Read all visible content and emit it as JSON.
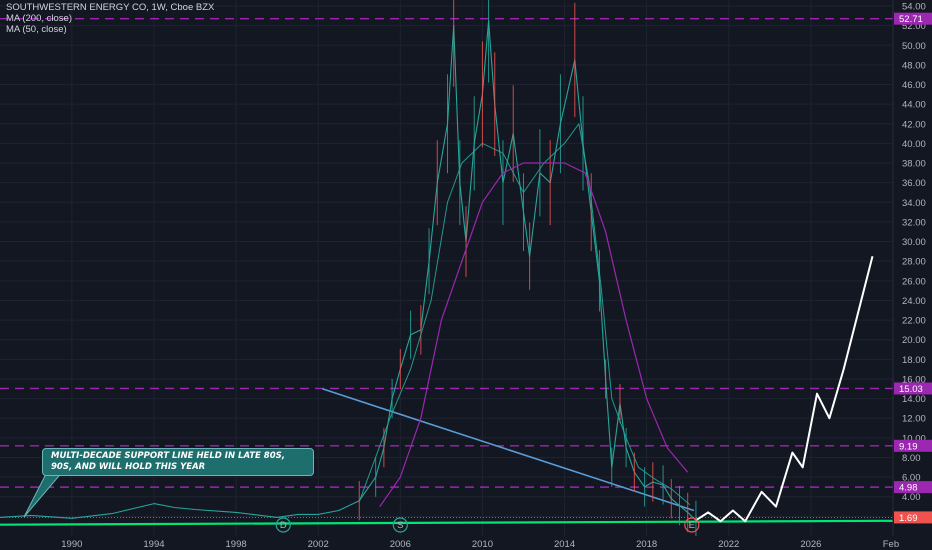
{
  "legend": {
    "title": "SOUTHWESTERN ENERGY CO, 1W, Cboe BZX",
    "ma200": "MA (200, close)",
    "ma50": "MA (50, close)"
  },
  "annotation": {
    "text": "MULTI-DECADE SUPPORT LINE HELD IN LATE 80S, 90S, AND WILL HOLD THIS YEAR"
  },
  "chart_data": {
    "type": "line",
    "title": "SOUTHWESTERN ENERGY CO, 1W, Cboe BZX",
    "xlabel": "",
    "ylabel": "",
    "xlim": [
      1986.5,
      2030.0
    ],
    "ylim": [
      0,
      54
    ],
    "x_ticks": [
      "1990",
      "1994",
      "1998",
      "2002",
      "2006",
      "2010",
      "2014",
      "2018",
      "2022",
      "2026",
      "Feb"
    ],
    "y_ticks": [
      "54.00",
      "52.00",
      "50.00",
      "48.00",
      "46.00",
      "44.00",
      "42.00",
      "40.00",
      "38.00",
      "36.00",
      "34.00",
      "32.00",
      "30.00",
      "28.00",
      "26.00",
      "24.00",
      "22.00",
      "20.00",
      "18.00",
      "16.00",
      "14.00",
      "12.00",
      "10.00",
      "8.00",
      "6.00",
      "4.00",
      "2.00"
    ],
    "horizontal_levels": [
      {
        "value": 52.71,
        "label": "52.71",
        "color": "#9c27b0"
      },
      {
        "value": 15.03,
        "label": "15.03",
        "color": "#9c27b0"
      },
      {
        "value": 9.19,
        "label": "9.19",
        "color": "#9c27b0"
      },
      {
        "value": 4.98,
        "label": "4.98",
        "color": "#9c27b0"
      }
    ],
    "current_price": {
      "value": 1.69,
      "label": "1.69",
      "color": "#ef5350"
    },
    "series": [
      {
        "name": "price",
        "color": "#26a69a",
        "points": [
          [
            1986.5,
            1.9
          ],
          [
            1988,
            2.1
          ],
          [
            1990,
            1.8
          ],
          [
            1992,
            2.3
          ],
          [
            1993,
            2.8
          ],
          [
            1994,
            3.3
          ],
          [
            1995,
            2.9
          ],
          [
            1996,
            2.7
          ],
          [
            1998,
            2.4
          ],
          [
            2000,
            1.9
          ],
          [
            2001,
            2.2
          ],
          [
            2002,
            2.2
          ],
          [
            2003,
            2.6
          ],
          [
            2004,
            3.6
          ],
          [
            2004.8,
            6.0
          ],
          [
            2005.2,
            9.0
          ],
          [
            2005.6,
            14.0
          ],
          [
            2006,
            17.0
          ],
          [
            2006.5,
            20.5
          ],
          [
            2007,
            21.0
          ],
          [
            2007.4,
            28.0
          ],
          [
            2007.8,
            36.0
          ],
          [
            2008.3,
            42.0
          ],
          [
            2008.6,
            52.0
          ],
          [
            2008.9,
            36.0
          ],
          [
            2009.2,
            30.0
          ],
          [
            2009.6,
            40.0
          ],
          [
            2010,
            45.0
          ],
          [
            2010.3,
            52.5
          ],
          [
            2010.6,
            44.0
          ],
          [
            2011,
            36.0
          ],
          [
            2011.5,
            41.0
          ],
          [
            2012,
            33.0
          ],
          [
            2012.3,
            28.5
          ],
          [
            2012.8,
            37.0
          ],
          [
            2013.3,
            36.0
          ],
          [
            2013.8,
            42.0
          ],
          [
            2014.5,
            48.5
          ],
          [
            2014.9,
            40.0
          ],
          [
            2015.3,
            33.0
          ],
          [
            2015.7,
            26.0
          ],
          [
            2016,
            16.0
          ],
          [
            2016.3,
            7.0
          ],
          [
            2016.7,
            13.5
          ],
          [
            2017,
            9.0
          ],
          [
            2017.4,
            6.5
          ],
          [
            2017.9,
            5.0
          ],
          [
            2018.3,
            5.5
          ],
          [
            2018.8,
            5.2
          ],
          [
            2019.2,
            3.8
          ],
          [
            2019.6,
            3.1
          ],
          [
            2020,
            2.4
          ],
          [
            2020.4,
            1.6
          ]
        ]
      },
      {
        "name": "MA (50, close)",
        "color": "#26a69a",
        "points": [
          [
            2004,
            3.5
          ],
          [
            2005.5,
            12.0
          ],
          [
            2006.5,
            17.0
          ],
          [
            2007.5,
            24.0
          ],
          [
            2008.3,
            34.0
          ],
          [
            2009,
            38.0
          ],
          [
            2010,
            40.0
          ],
          [
            2011,
            39.0
          ],
          [
            2012,
            35.0
          ],
          [
            2013,
            38.0
          ],
          [
            2014,
            40.0
          ],
          [
            2014.7,
            42.0
          ],
          [
            2015.2,
            36.0
          ],
          [
            2015.8,
            25.0
          ],
          [
            2016.3,
            14.0
          ],
          [
            2017,
            10.0
          ],
          [
            2017.6,
            7.0
          ],
          [
            2018.4,
            5.8
          ],
          [
            2019.2,
            4.8
          ],
          [
            2020.1,
            3.2
          ]
        ]
      },
      {
        "name": "MA (200, close)",
        "color": "#9c27b0",
        "points": [
          [
            2005,
            3.0
          ],
          [
            2006,
            6.0
          ],
          [
            2007,
            12.0
          ],
          [
            2008,
            22.0
          ],
          [
            2009,
            28.0
          ],
          [
            2010,
            34.0
          ],
          [
            2011,
            37.0
          ],
          [
            2012,
            38.0
          ],
          [
            2013,
            38.0
          ],
          [
            2014,
            38.0
          ],
          [
            2015,
            37.0
          ],
          [
            2016,
            31.0
          ],
          [
            2017,
            22.0
          ],
          [
            2018,
            14.0
          ],
          [
            2019,
            9.0
          ],
          [
            2020,
            6.5
          ]
        ]
      },
      {
        "name": "projection",
        "color": "#ffffff",
        "points": [
          [
            2020.4,
            1.6
          ],
          [
            2021.0,
            2.4
          ],
          [
            2021.6,
            1.5
          ],
          [
            2022.2,
            2.6
          ],
          [
            2022.8,
            1.5
          ],
          [
            2023.6,
            4.5
          ],
          [
            2024.3,
            3.0
          ],
          [
            2025.1,
            8.5
          ],
          [
            2025.6,
            7.0
          ],
          [
            2026.3,
            14.5
          ],
          [
            2026.9,
            12.0
          ],
          [
            2027.6,
            17.0
          ],
          [
            2029.0,
            28.5
          ]
        ]
      }
    ],
    "support_line": {
      "color": "#00e676",
      "points": [
        [
          1986.5,
          1.15
        ],
        [
          2030.0,
          1.55
        ]
      ]
    },
    "trend_line": {
      "color": "#5b9bd5",
      "points": [
        [
          2002.2,
          15.0
        ],
        [
          2020.3,
          2.6
        ]
      ]
    },
    "event_markers": [
      {
        "label": "D",
        "x": 2000.3
      },
      {
        "label": "S",
        "x": 2006.0
      },
      {
        "label": "E",
        "x": 2020.2
      }
    ]
  }
}
